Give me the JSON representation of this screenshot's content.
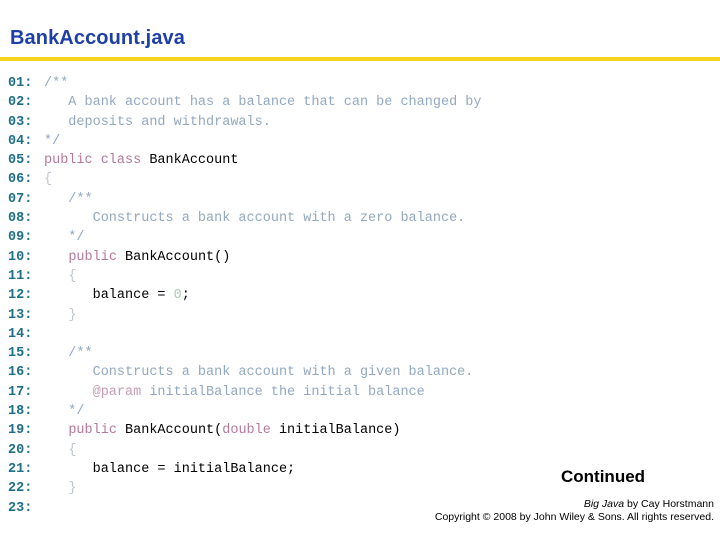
{
  "header": {
    "title": "BankAccount.java",
    "title_color": "#1F3FA8",
    "rule_color": "#F6D320"
  },
  "colors": {
    "line_number": "#1D6E87",
    "comment": "#93A8C0",
    "javadoc_tag": "#C49BB4",
    "keyword": "#B4789B",
    "identifier": "#000000",
    "brace": "#BFC7CF",
    "number_literal": "#AFC8AF",
    "background": "#FFFFFF"
  },
  "code": {
    "language": "java",
    "line_numbers": [
      "01:",
      "02:",
      "03:",
      "04:",
      "05:",
      "06:",
      "07:",
      "08:",
      "09:",
      "10:",
      "11:",
      "12:",
      "13:",
      "14:",
      "15:",
      "16:",
      "17:",
      "18:",
      "19:",
      "20:",
      "21:",
      "22:",
      "23:"
    ],
    "lines": [
      "/**",
      "   A bank account has a balance that can be changed by",
      "   deposits and withdrawals.",
      "*/",
      "public class BankAccount",
      "{",
      "   /**",
      "      Constructs a bank account with a zero balance.",
      "   */",
      "   public BankAccount()",
      "   {",
      "      balance = 0;",
      "   }",
      "",
      "   /**",
      "      Constructs a bank account with a given balance.",
      "      @param initialBalance the initial balance",
      "   */",
      "   public BankAccount(double initialBalance)",
      "   {",
      "      balance = initialBalance;",
      "   }",
      ""
    ],
    "tokens": {
      "l1": [
        {
          "t": "/**",
          "c": "comment"
        }
      ],
      "l2": [
        {
          "t": "   A bank account has a balance that can be changed by",
          "c": "comment"
        }
      ],
      "l3": [
        {
          "t": "   deposits and withdrawals.",
          "c": "comment"
        }
      ],
      "l4": [
        {
          "t": "*/",
          "c": "comment"
        }
      ],
      "l5": [
        {
          "t": "public class ",
          "c": "keyword"
        },
        {
          "t": "BankAccount",
          "c": "ident"
        }
      ],
      "l6": [
        {
          "t": "{",
          "c": "brace"
        }
      ],
      "l7": [
        {
          "t": "   /**",
          "c": "comment"
        }
      ],
      "l8": [
        {
          "t": "      Constructs a bank account with a zero balance.",
          "c": "comment"
        }
      ],
      "l9": [
        {
          "t": "   */",
          "c": "comment"
        }
      ],
      "l10": [
        {
          "t": "   ",
          "c": "punct"
        },
        {
          "t": "public ",
          "c": "keyword"
        },
        {
          "t": "BankAccount()",
          "c": "ident"
        }
      ],
      "l11": [
        {
          "t": "   ",
          "c": "punct"
        },
        {
          "t": "{",
          "c": "brace"
        }
      ],
      "l12": [
        {
          "t": "      balance = ",
          "c": "ident"
        },
        {
          "t": "0",
          "c": "number"
        },
        {
          "t": ";",
          "c": "ident"
        }
      ],
      "l13": [
        {
          "t": "   ",
          "c": "punct"
        },
        {
          "t": "}",
          "c": "brace"
        }
      ],
      "l14": [],
      "l15": [
        {
          "t": "   /**",
          "c": "comment"
        }
      ],
      "l16": [
        {
          "t": "      Constructs a bank account with a given balance.",
          "c": "comment"
        }
      ],
      "l17": [
        {
          "t": "      ",
          "c": "comment"
        },
        {
          "t": "@param",
          "c": "tag"
        },
        {
          "t": " initialBalance the initial balance",
          "c": "comment"
        }
      ],
      "l18": [
        {
          "t": "   */",
          "c": "comment"
        }
      ],
      "l19": [
        {
          "t": "   ",
          "c": "punct"
        },
        {
          "t": "public ",
          "c": "keyword"
        },
        {
          "t": "BankAccount(",
          "c": "ident"
        },
        {
          "t": "double",
          "c": "keyword"
        },
        {
          "t": " initialBalance)",
          "c": "ident"
        }
      ],
      "l20": [
        {
          "t": "   ",
          "c": "punct"
        },
        {
          "t": "{",
          "c": "brace"
        }
      ],
      "l21": [
        {
          "t": "      balance = initialBalance;",
          "c": "ident"
        }
      ],
      "l22": [
        {
          "t": "   ",
          "c": "punct"
        },
        {
          "t": "}",
          "c": "brace"
        }
      ],
      "l23": []
    }
  },
  "continued": {
    "label": "Continued"
  },
  "footer": {
    "line1_italic": "Big Java",
    "line1_rest": " by Cay Horstmann",
    "line2": "Copyright © 2008 by John Wiley & Sons.  All rights reserved."
  }
}
